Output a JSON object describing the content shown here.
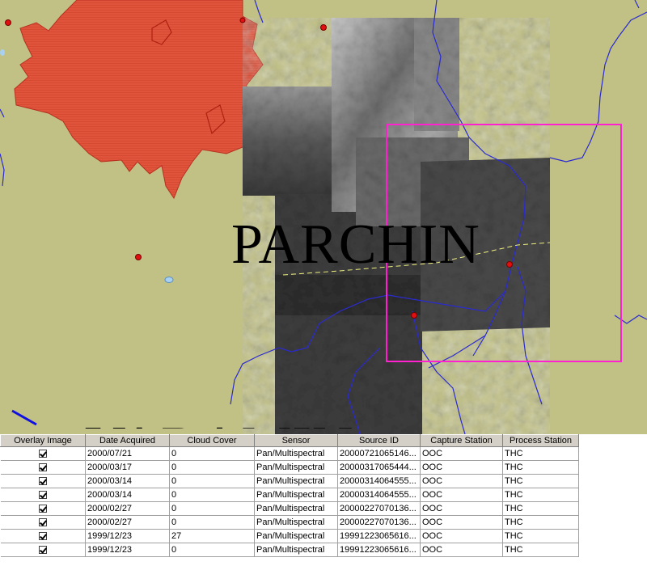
{
  "map": {
    "labels": {
      "parchin": "PARCHIN",
      "varamin": "VARAMIN"
    },
    "colors": {
      "background": "#c1c185",
      "urban": "#e0543c",
      "rivers": "#2a2ad0",
      "selection_box": "#ff20d0",
      "city_point": "#e01010",
      "lake": "#a8d0f0"
    }
  },
  "grid": {
    "columns": [
      "Overlay Image",
      "Date Acquired",
      "Cloud Cover",
      "Sensor",
      "Source ID",
      "Capture Station",
      "Process Station"
    ],
    "rows": [
      {
        "overlay": true,
        "date": "2000/07/21",
        "cloud": "0",
        "sensor": "Pan/Multispectral",
        "source_id": "20000721065146...",
        "capture": "OOC",
        "process": "THC"
      },
      {
        "overlay": true,
        "date": "2000/03/17",
        "cloud": "0",
        "sensor": "Pan/Multispectral",
        "source_id": "20000317065444...",
        "capture": "OOC",
        "process": "THC"
      },
      {
        "overlay": true,
        "date": "2000/03/14",
        "cloud": "0",
        "sensor": "Pan/Multispectral",
        "source_id": "20000314064555...",
        "capture": "OOC",
        "process": "THC"
      },
      {
        "overlay": true,
        "date": "2000/03/14",
        "cloud": "0",
        "sensor": "Pan/Multispectral",
        "source_id": "20000314064555...",
        "capture": "OOC",
        "process": "THC"
      },
      {
        "overlay": true,
        "date": "2000/02/27",
        "cloud": "0",
        "sensor": "Pan/Multispectral",
        "source_id": "20000227070136...",
        "capture": "OOC",
        "process": "THC"
      },
      {
        "overlay": true,
        "date": "2000/02/27",
        "cloud": "0",
        "sensor": "Pan/Multispectral",
        "source_id": "20000227070136...",
        "capture": "OOC",
        "process": "THC"
      },
      {
        "overlay": true,
        "date": "1999/12/23",
        "cloud": "27",
        "sensor": "Pan/Multispectral",
        "source_id": "19991223065616...",
        "capture": "OOC",
        "process": "THC"
      },
      {
        "overlay": true,
        "date": "1999/12/23",
        "cloud": "0",
        "sensor": "Pan/Multispectral",
        "source_id": "19991223065616...",
        "capture": "OOC",
        "process": "THC"
      }
    ]
  }
}
